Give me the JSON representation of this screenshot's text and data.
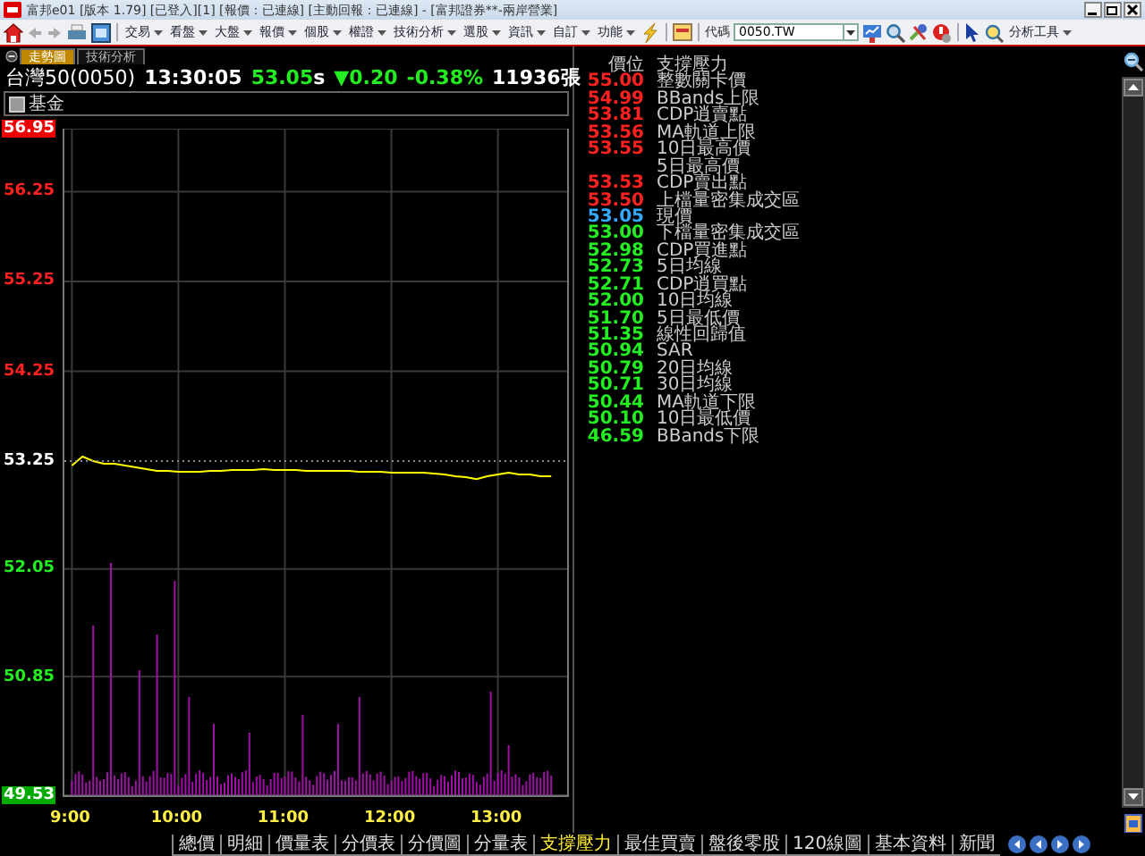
{
  "window": {
    "title": "富邦e01 [版本 1.79] [已登入][1] [報價：已連線] [主動回報：已連線] - [富邦證券**-兩岸營業]"
  },
  "toolbar": {
    "menus": [
      "交易",
      "看盤",
      "大盤",
      "報價",
      "個股",
      "權證",
      "技術分析",
      "選股",
      "資訊",
      "自訂",
      "功能"
    ],
    "code_label": "代碼",
    "code_value": "0050.TW",
    "tools_label": "分析工具"
  },
  "tabs": [
    {
      "label": "走勢圖",
      "selected": true
    },
    {
      "label": "技術分析",
      "selected": false
    }
  ],
  "quote": {
    "name": "台灣50(0050)",
    "time": "13:30:05",
    "price": "53.05",
    "price_flag": "s",
    "change_arrow": "▼",
    "change": "0.20",
    "change_pct": "-0.38%",
    "volume": "11936張",
    "falling": true
  },
  "options": [
    {
      "label": "基金",
      "checked": false
    }
  ],
  "chart": {
    "chart_data": {
      "type": "line",
      "x": [
        9.0,
        9.1,
        9.2,
        9.3,
        9.4,
        9.5,
        9.6,
        9.7,
        9.8,
        9.9,
        10.0,
        10.1,
        10.2,
        10.3,
        10.4,
        10.5,
        10.6,
        10.7,
        10.8,
        10.9,
        11.0,
        11.1,
        11.2,
        11.3,
        11.4,
        11.5,
        11.6,
        11.7,
        11.8,
        11.9,
        12.0,
        12.1,
        12.2,
        12.3,
        12.4,
        12.5,
        12.6,
        12.7,
        12.8,
        12.9,
        13.0,
        13.1,
        13.2,
        13.3,
        13.4,
        13.5
      ],
      "series": [
        {
          "color": "#ffff00",
          "values": [
            53.2,
            53.3,
            53.25,
            53.22,
            53.22,
            53.2,
            53.18,
            53.16,
            53.14,
            53.14,
            53.13,
            53.13,
            53.13,
            53.14,
            53.14,
            53.15,
            53.15,
            53.15,
            53.16,
            53.15,
            53.15,
            53.15,
            53.14,
            53.14,
            53.14,
            53.14,
            53.14,
            53.13,
            53.13,
            53.13,
            53.12,
            53.12,
            53.12,
            53.12,
            53.11,
            53.1,
            53.08,
            53.07,
            53.05,
            53.08,
            53.1,
            53.12,
            53.1,
            53.1,
            53.08,
            53.08
          ]
        }
      ],
      "xlim": [
        8.93,
        13.65
      ],
      "ylim": [
        49.53,
        56.95
      ],
      "xticks": [
        {
          "value": 9,
          "label": "9:00"
        },
        {
          "value": 10,
          "label": "10:00"
        },
        {
          "value": 11,
          "label": "11:00"
        },
        {
          "value": 12,
          "label": "12:00"
        },
        {
          "value": 13,
          "label": "13:00"
        }
      ],
      "yticks": [
        {
          "value": 56.95,
          "label": "56.95"
        },
        {
          "value": 56.25,
          "label": "56.25"
        },
        {
          "value": 55.25,
          "label": "55.25"
        },
        {
          "value": 54.25,
          "label": "54.25"
        },
        {
          "value": 53.25,
          "label": "53.25"
        },
        {
          "value": 52.05,
          "label": "52.05"
        },
        {
          "value": 50.85,
          "label": "50.85"
        },
        {
          "value": 49.53,
          "label": "49.53"
        }
      ],
      "grid": true
    },
    "tick_styles": [
      {
        "kind": "limit_up"
      },
      {
        "kind": "up"
      },
      {
        "kind": "up"
      },
      {
        "kind": "up"
      },
      {
        "kind": "reference"
      },
      {
        "kind": "down"
      },
      {
        "kind": "down"
      },
      {
        "kind": "limit_down"
      }
    ]
  },
  "levels": {
    "columns": [
      "價位",
      "支撐壓力"
    ],
    "rows": [
      {
        "price": "55.00",
        "label": "整數關卡價",
        "kind": "up"
      },
      {
        "price": "54.99",
        "label": "BBands上限",
        "kind": "up"
      },
      {
        "price": "53.81",
        "label": "CDP逍賣點",
        "kind": "up"
      },
      {
        "price": "53.56",
        "label": "MA軌道上限",
        "kind": "up"
      },
      {
        "price": "53.55",
        "label": "10日最高價",
        "kind": "up"
      },
      {
        "label": "5日最高價",
        "kind": "up"
      },
      {
        "price": "53.53",
        "label": "CDP賣出點",
        "kind": "up"
      },
      {
        "price": "53.50",
        "label": "上檔量密集成交區",
        "kind": "up"
      },
      {
        "price": "53.05",
        "label": "現價",
        "kind": "current"
      },
      {
        "price": "53.00",
        "label": "下檔量密集成交區",
        "kind": "down"
      },
      {
        "price": "52.98",
        "label": "CDP買進點",
        "kind": "down"
      },
      {
        "price": "52.73",
        "label": "5日均線",
        "kind": "down"
      },
      {
        "price": "52.71",
        "label": "CDP逍買點",
        "kind": "down"
      },
      {
        "price": "52.00",
        "label": "10日均線",
        "kind": "down"
      },
      {
        "price": "51.70",
        "label": "5日最低價",
        "kind": "down"
      },
      {
        "price": "51.35",
        "label": "線性回歸值",
        "kind": "down"
      },
      {
        "price": "50.94",
        "label": "SAR",
        "kind": "down"
      },
      {
        "price": "50.79",
        "label": "20日均線",
        "kind": "down"
      },
      {
        "price": "50.71",
        "label": "30日均線",
        "kind": "down"
      },
      {
        "price": "50.44",
        "label": "MA軌道下限",
        "kind": "down"
      },
      {
        "price": "50.10",
        "label": "10日最低價",
        "kind": "down"
      },
      {
        "price": "46.59",
        "label": "BBands下限",
        "kind": "down"
      }
    ]
  },
  "bottom_tabs": [
    {
      "label": "總價",
      "selected": false
    },
    {
      "label": "明細",
      "selected": false
    },
    {
      "label": "價量表",
      "selected": false
    },
    {
      "label": "分價表",
      "selected": false
    },
    {
      "label": "分價圖",
      "selected": false
    },
    {
      "label": "分量表",
      "selected": false
    },
    {
      "label": "支撐壓力",
      "selected": true
    },
    {
      "label": "最佳買賣",
      "selected": false
    },
    {
      "label": "盤後零股",
      "selected": false
    },
    {
      "label": "120線圖",
      "selected": false
    },
    {
      "label": "基本資料",
      "selected": false
    },
    {
      "label": "新聞",
      "selected": false
    }
  ]
}
